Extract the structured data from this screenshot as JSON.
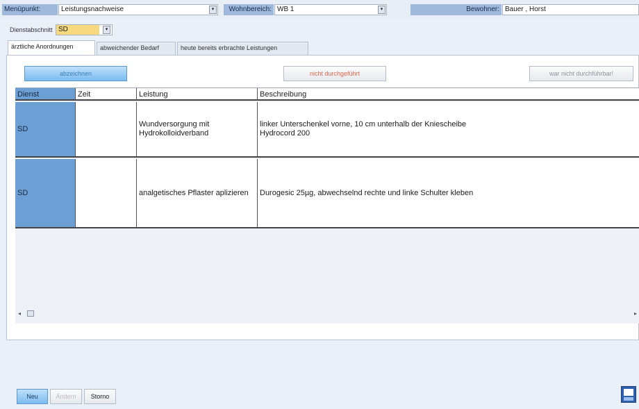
{
  "header": {
    "menu_label": "Menüpunkt:",
    "menu_value": "Leistungsnachweise",
    "area_label": "Wohnbereich:",
    "area_value": "WB 1",
    "resident_label": "Bewohner:",
    "resident_value": "Bauer , Horst",
    "dropdown_glyph": "▾"
  },
  "shift": {
    "label": "Dienstabschnitt",
    "value": "SD"
  },
  "tabs": [
    {
      "label": "ärztliche Anordnungen",
      "active": true
    },
    {
      "label": "abweichender Bedarf",
      "active": false
    },
    {
      "label": "heute bereits erbrachte Leistungen",
      "active": false
    }
  ],
  "actions": {
    "sign_off": "abzeichnen",
    "not_done": "nicht durchgeführt",
    "not_feasible": "war nicht durchführbar!"
  },
  "grid": {
    "columns": [
      "Dienst",
      "Zeit",
      "Leistung",
      "Beschreibung"
    ],
    "rows": [
      {
        "dienst": "SD",
        "zeit": "",
        "leistung": "Wundversorgung mit Hydrokolloidverband",
        "beschreibung_line1": "linker Unterschenkel vorne, 10 cm unterhalb der Kniescheibe",
        "beschreibung_line2": "Hydrocord 200"
      },
      {
        "dienst": "SD",
        "zeit": "",
        "leistung": "analgetisches Pflaster aplizieren",
        "beschreibung_line1": "Durogesic 25µg, abwechselnd rechte und linke Schulter kleben",
        "beschreibung_line2": ""
      }
    ],
    "scroll_left_glyph": "◂",
    "scroll_right_glyph": "▸"
  },
  "footer": {
    "new_label": "Neu",
    "change_label": "Ändern",
    "cancel_label": "Storno",
    "corner_icon": "window-icon"
  },
  "colors": {
    "accent_blue": "#6c9fd4",
    "label_blue": "#9fb9dc",
    "shift_yellow": "#f7d980",
    "warning_red": "#e0664a"
  }
}
